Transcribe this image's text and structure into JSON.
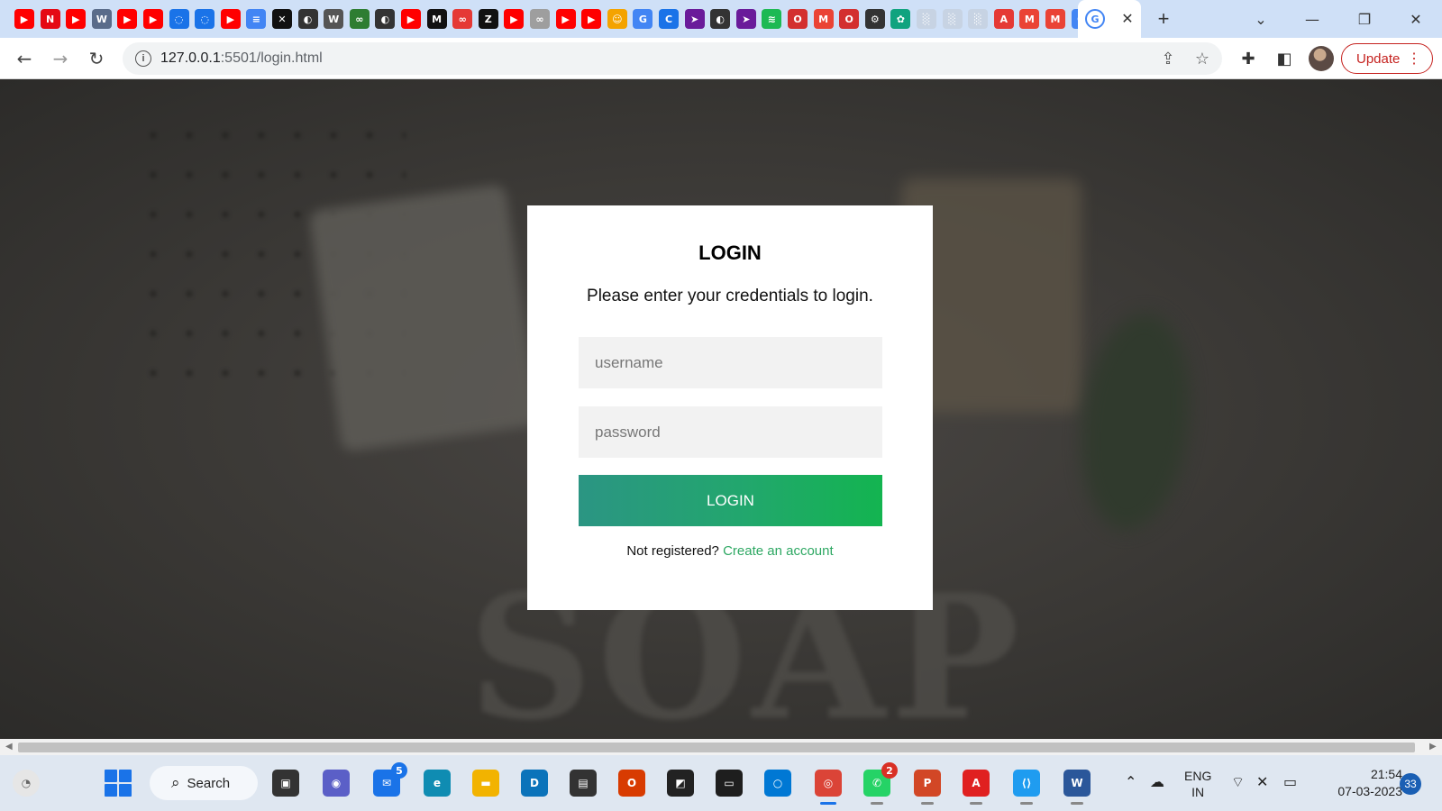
{
  "browser": {
    "tabs": [
      {
        "icon": "youtube-icon",
        "glyph": "▶",
        "color": "#ff0000"
      },
      {
        "icon": "netflix-icon",
        "glyph": "N",
        "color": "#e50914"
      },
      {
        "icon": "youtube-icon",
        "glyph": "▶",
        "color": "#ff0000"
      },
      {
        "icon": "wordpress-icon",
        "glyph": "W",
        "color": "#5a6c8a"
      },
      {
        "icon": "youtube-icon",
        "glyph": "▶",
        "color": "#ff0000"
      },
      {
        "icon": "youtube-icon",
        "glyph": "▶",
        "color": "#ff0000"
      },
      {
        "icon": "chat-icon",
        "glyph": "◌",
        "color": "#1a73e8"
      },
      {
        "icon": "chat-icon",
        "glyph": "◌",
        "color": "#1a73e8"
      },
      {
        "icon": "youtube-icon",
        "glyph": "▶",
        "color": "#ff0000"
      },
      {
        "icon": "docs-icon",
        "glyph": "≡",
        "color": "#4285f4"
      },
      {
        "icon": "capcut-icon",
        "glyph": "✕",
        "color": "#111111"
      },
      {
        "icon": "globe-icon",
        "glyph": "◐",
        "color": "#333333"
      },
      {
        "icon": "wikipedia-icon",
        "glyph": "W",
        "color": "#555555"
      },
      {
        "icon": "link-icon",
        "glyph": "∞",
        "color": "#2e7d32"
      },
      {
        "icon": "globe-icon",
        "glyph": "◐",
        "color": "#333333"
      },
      {
        "icon": "youtube-icon",
        "glyph": "▶",
        "color": "#ff0000"
      },
      {
        "icon": "medium-icon",
        "glyph": "M",
        "color": "#111111"
      },
      {
        "icon": "link-icon",
        "glyph": "∞",
        "color": "#e53935"
      },
      {
        "icon": "notion-icon",
        "glyph": "Z",
        "color": "#111111"
      },
      {
        "icon": "youtube-icon",
        "glyph": "▶",
        "color": "#ff0000"
      },
      {
        "icon": "link-icon",
        "glyph": "∞",
        "color": "#9e9e9e"
      },
      {
        "icon": "youtube-icon",
        "glyph": "▶",
        "color": "#ff0000"
      },
      {
        "icon": "youtube-icon",
        "glyph": "▶",
        "color": "#ff0000"
      },
      {
        "icon": "avatar-icon",
        "glyph": "☺",
        "color": "#f4a300"
      },
      {
        "icon": "google-icon",
        "glyph": "G",
        "color": "#4285f4"
      },
      {
        "icon": "c-icon",
        "glyph": "C",
        "color": "#1a73e8"
      },
      {
        "icon": "arrow-icon",
        "glyph": "➤",
        "color": "#6a1b9a"
      },
      {
        "icon": "globe-icon",
        "glyph": "◐",
        "color": "#333333"
      },
      {
        "icon": "arrow-icon",
        "glyph": "➤",
        "color": "#6a1b9a"
      },
      {
        "icon": "spotify-icon",
        "glyph": "≋",
        "color": "#1db954"
      },
      {
        "icon": "opera-icon",
        "glyph": "O",
        "color": "#d32f2f"
      },
      {
        "icon": "gmail-icon",
        "glyph": "M",
        "color": "#ea4335"
      },
      {
        "icon": "opera-icon",
        "glyph": "O",
        "color": "#d32f2f"
      },
      {
        "icon": "gear-icon",
        "glyph": "⚙",
        "color": "#333333"
      },
      {
        "icon": "openai-icon",
        "glyph": "✿",
        "color": "#10a37f"
      },
      {
        "icon": "blank-page-icon",
        "glyph": "░",
        "color": "#c7d3e3"
      },
      {
        "icon": "blank-page-icon",
        "glyph": "░",
        "color": "#c7d3e3"
      },
      {
        "icon": "blank-page-icon",
        "glyph": "░",
        "color": "#c7d3e3"
      },
      {
        "icon": "acrobat-icon",
        "glyph": "A",
        "color": "#e53935"
      },
      {
        "icon": "gmail-icon",
        "glyph": "M",
        "color": "#ea4335"
      },
      {
        "icon": "gmail-icon",
        "glyph": "M",
        "color": "#ea4335"
      },
      {
        "icon": "google-icon",
        "glyph": "G",
        "color": "#4285f4"
      }
    ],
    "active_tab": {
      "icon": "google-icon",
      "glyph": "G"
    },
    "url_host": "127.0.0.1",
    "url_path": ":5501/login.html",
    "update_label": "Update"
  },
  "login": {
    "title": "LOGIN",
    "subtitle": "Please enter your credentials to login.",
    "username_placeholder": "username",
    "password_placeholder": "password",
    "button_label": "LOGIN",
    "register_prompt": "Not registered?",
    "register_link": "Create an account"
  },
  "background_word": "SOAP",
  "taskbar": {
    "search_label": "Search",
    "apps": [
      {
        "name": "task-view-icon",
        "glyph": "▣",
        "color": "#333333"
      },
      {
        "name": "teams-chat-icon",
        "glyph": "◉",
        "color": "#5b5fc7"
      },
      {
        "name": "mail-icon",
        "glyph": "✉",
        "color": "#1a73e8",
        "badge": "5"
      },
      {
        "name": "edge-icon",
        "glyph": "e",
        "color": "#0f8cb2"
      },
      {
        "name": "file-explorer-icon",
        "glyph": "▬",
        "color": "#f2b300"
      },
      {
        "name": "dell-icon",
        "glyph": "D",
        "color": "#0b73ba"
      },
      {
        "name": "media-icon",
        "glyph": "▤",
        "color": "#333333"
      },
      {
        "name": "office-icon",
        "glyph": "O",
        "color": "#d83b01"
      },
      {
        "name": "sticky-notes-icon",
        "glyph": "◩",
        "color": "#222222"
      },
      {
        "name": "terminal-icon",
        "glyph": "▭",
        "color": "#1e1e1e"
      },
      {
        "name": "photos-icon",
        "glyph": "○",
        "color": "#0078d4"
      },
      {
        "name": "chrome-icon",
        "glyph": "◎",
        "color": "#db4437"
      },
      {
        "name": "whatsapp-icon",
        "glyph": "✆",
        "color": "#25d366",
        "badge": "2"
      },
      {
        "name": "powerpoint-icon",
        "glyph": "P",
        "color": "#d24726"
      },
      {
        "name": "acrobat-icon",
        "glyph": "A",
        "color": "#e02020"
      },
      {
        "name": "vscode-icon",
        "glyph": "⟨⟩",
        "color": "#1f9cf0"
      },
      {
        "name": "word-icon",
        "glyph": "W",
        "color": "#2b579a"
      }
    ],
    "language": "ENG",
    "region": "IN",
    "time": "21:54",
    "date": "07-03-2023",
    "notification_count": "33"
  }
}
